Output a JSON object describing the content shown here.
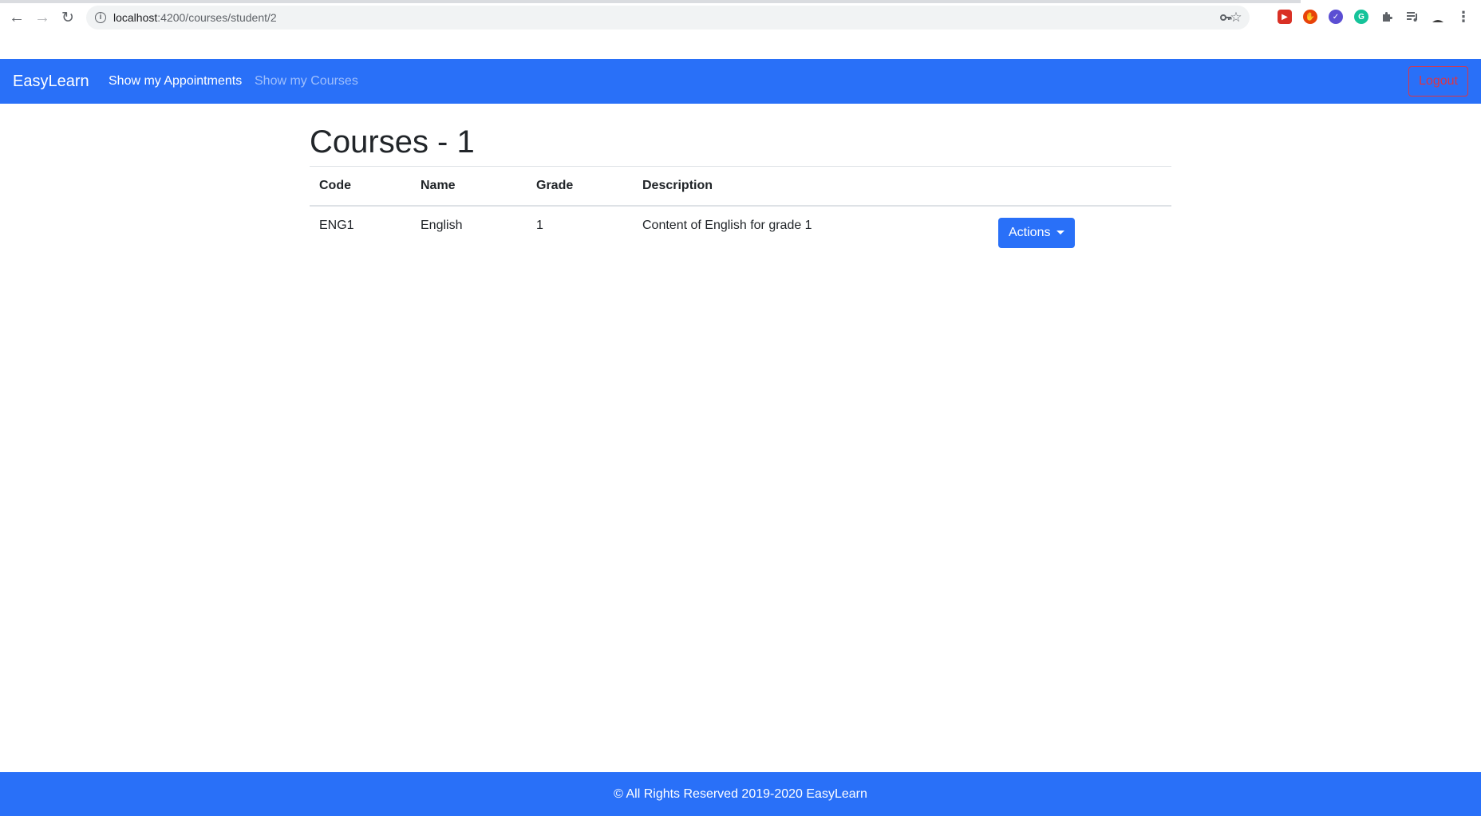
{
  "browser": {
    "url_host": "localhost",
    "url_rest": ":4200/courses/student/2"
  },
  "navbar": {
    "brand": "EasyLearn",
    "links": [
      {
        "label": "Show my Appointments",
        "active": true
      },
      {
        "label": "Show my Courses",
        "active": false
      }
    ],
    "logout_label": "Logout",
    "brand_color": "#2970f8",
    "logout_color": "#dc3545"
  },
  "main": {
    "title": "Courses - 1",
    "table": {
      "headers": [
        "Code",
        "Name",
        "Grade",
        "Description",
        ""
      ],
      "rows": [
        {
          "code": "ENG1",
          "name": "English",
          "grade": "1",
          "description": "Content of English for grade 1",
          "action_label": "Actions"
        }
      ]
    }
  },
  "footer": {
    "text": "© All Rights Reserved 2019-2020 EasyLearn"
  }
}
